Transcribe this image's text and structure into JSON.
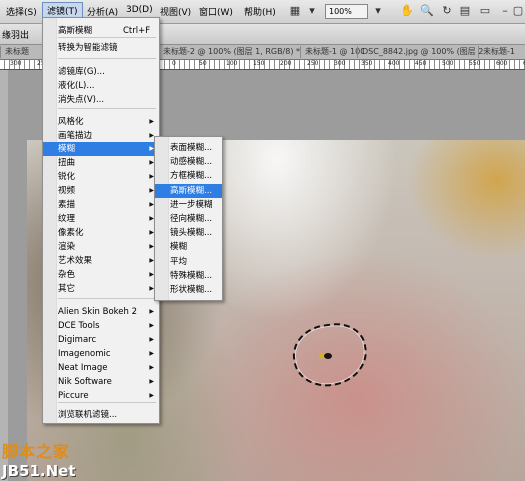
{
  "menubar": {
    "items": [
      "选择(S)",
      "滤镜(T)",
      "分析(A)",
      "3D(D)",
      "视图(V)",
      "窗口(W)",
      "帮助(H)"
    ],
    "zoom": "100%",
    "icons": [
      "grid-icon",
      "zoom-icon",
      "hand-icon",
      "rotate-icon",
      "arrange-icon",
      "screen-mode-icon",
      "minimize-icon",
      "restore-icon"
    ]
  },
  "options_bar": {
    "label": "缘羽出"
  },
  "doc_tabs": [
    {
      "label": "未标题"
    },
    {
      "label": "未标题-2 @ 100% (图层 1, RGB/8) *"
    },
    {
      "label": "未标题-1 @ 100% (图层 2, RGB/8) *"
    },
    {
      "label": "DSC_8842.jpg @ 100% (图层 2, RGB/8) *"
    },
    {
      "label": "未标题-1"
    }
  ],
  "ruler": {
    "labels": [
      "300",
      "250",
      "200",
      "150",
      "100",
      "50",
      "0",
      "50",
      "100",
      "150",
      "200",
      "250",
      "300",
      "350",
      "400",
      "450",
      "500",
      "550",
      "600",
      "650"
    ]
  },
  "filter_menu": {
    "items": [
      {
        "label": "高斯模糊",
        "shortcut": "Ctrl+F",
        "submenu": false
      },
      {
        "label": "转换为智能滤镜",
        "submenu": false
      },
      {
        "label": "滤镜库(G)...",
        "submenu": false
      },
      {
        "label": "液化(L)...",
        "submenu": false
      },
      {
        "label": "消失点(V)...",
        "submenu": false
      },
      {
        "label": "风格化",
        "submenu": true
      },
      {
        "label": "画笔描边",
        "submenu": true
      },
      {
        "label": "模糊",
        "submenu": true,
        "highlighted": true
      },
      {
        "label": "扭曲",
        "submenu": true
      },
      {
        "label": "锐化",
        "submenu": true
      },
      {
        "label": "视频",
        "submenu": true
      },
      {
        "label": "素描",
        "submenu": true
      },
      {
        "label": "纹理",
        "submenu": true
      },
      {
        "label": "像素化",
        "submenu": true
      },
      {
        "label": "渲染",
        "submenu": true
      },
      {
        "label": "艺术效果",
        "submenu": true
      },
      {
        "label": "杂色",
        "submenu": true
      },
      {
        "label": "其它",
        "submenu": true
      },
      {
        "label": "Alien Skin Bokeh 2",
        "submenu": true
      },
      {
        "label": "DCE Tools",
        "submenu": true
      },
      {
        "label": "Digimarc",
        "submenu": true
      },
      {
        "label": "Imagenomic",
        "submenu": true
      },
      {
        "label": "Neat Image",
        "submenu": true
      },
      {
        "label": "Nik Software",
        "submenu": true
      },
      {
        "label": "Piccure",
        "submenu": true
      },
      {
        "label": "浏览联机滤镜...",
        "submenu": false
      }
    ]
  },
  "blur_submenu": {
    "items": [
      {
        "label": "表面模糊..."
      },
      {
        "label": "动感模糊..."
      },
      {
        "label": "方框模糊..."
      },
      {
        "label": "高斯模糊...",
        "highlighted": true
      },
      {
        "label": "进一步模糊"
      },
      {
        "label": "径向模糊..."
      },
      {
        "label": "镜头模糊..."
      },
      {
        "label": "模糊"
      },
      {
        "label": "平均"
      },
      {
        "label": "特殊模糊..."
      },
      {
        "label": "形状模糊..."
      }
    ]
  },
  "watermark": {
    "line1": "脚本之家",
    "line2": "JB51.Net"
  },
  "colors": {
    "highlight": "#2f7ee3",
    "menu_bg": "#f1f1f1",
    "workspace": "#9c9c9c"
  }
}
